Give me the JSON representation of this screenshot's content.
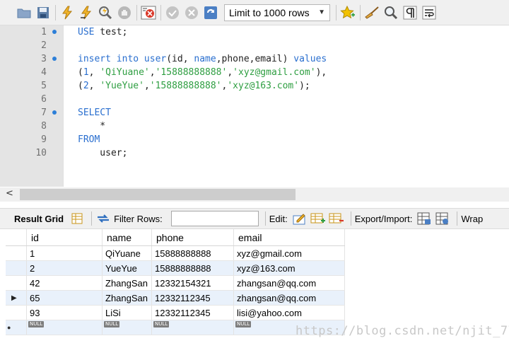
{
  "toolbar": {
    "limit_select_value": "Limit to 1000 rows",
    "buttons": [
      {
        "name": "open-folder-icon",
        "color": "#6f8fb8"
      },
      {
        "name": "save-icon",
        "color": "#5d7fa8"
      },
      {
        "name": "execute-lightning-icon",
        "color": "#e6a21c"
      },
      {
        "name": "execute-current-lightning-icon",
        "color": "#e6a21c"
      },
      {
        "name": "explain-magnifier-icon",
        "color": "#7a7a7a"
      },
      {
        "name": "stop-hand-icon",
        "color": "#9a9a9a"
      },
      {
        "name": "toggle-error-continue-icon",
        "color": "#d93a2b"
      },
      {
        "name": "commit-check-icon",
        "color": "#9a9a9a"
      },
      {
        "name": "rollback-cancel-icon",
        "color": "#9a9a9a"
      },
      {
        "name": "autocommit-toggle-icon",
        "color": "#4b7fc4"
      },
      {
        "name": "add-snippet-star-icon",
        "color": "#e8b400"
      },
      {
        "name": "beautify-broom-icon",
        "color": "#c08a2c"
      },
      {
        "name": "find-magnifier-icon",
        "color": "#555555"
      },
      {
        "name": "invisible-chars-pilcrow-icon",
        "color": "#333333"
      },
      {
        "name": "word-wrap-icon",
        "color": "#333333"
      }
    ]
  },
  "editor": {
    "lines": [
      {
        "num": "1",
        "marker": true
      },
      {
        "num": "2",
        "marker": false
      },
      {
        "num": "3",
        "marker": true
      },
      {
        "num": "4",
        "marker": false
      },
      {
        "num": "5",
        "marker": false
      },
      {
        "num": "6",
        "marker": false
      },
      {
        "num": "7",
        "marker": true
      },
      {
        "num": "8",
        "marker": false
      },
      {
        "num": "9",
        "marker": false
      },
      {
        "num": "10",
        "marker": false
      }
    ],
    "tokens": {
      "l1": [
        "USE",
        " test;"
      ],
      "l3": [
        "insert into user",
        "(id, ",
        "name",
        ",phone,email) ",
        "values"
      ],
      "l4": [
        "(",
        "1",
        ", ",
        "'QiYuane'",
        ",",
        "'15888888888'",
        ",",
        "'xyz@gmail.com'",
        "),"
      ],
      "l5": [
        "(",
        "2",
        ", ",
        "'YueYue'",
        ",",
        "'15888888888'",
        ",",
        "'xyz@163.com'",
        ");"
      ],
      "l7": [
        "SELECT"
      ],
      "l8": [
        "    *"
      ],
      "l9": [
        "FROM"
      ],
      "l10": [
        "    user;"
      ]
    }
  },
  "result_toolbar": {
    "result_grid_label": "Result Grid",
    "filter_label": "Filter Rows:",
    "filter_value": "",
    "edit_label": "Edit:",
    "export_label": "Export/Import:",
    "wrap_label": "Wrap"
  },
  "grid": {
    "columns": [
      "id",
      "name",
      "phone",
      "email"
    ],
    "rows": [
      {
        "id": "1",
        "name": "QiYuane",
        "phone": "15888888888",
        "email": "xyz@gmail.com",
        "current": false
      },
      {
        "id": "2",
        "name": "YueYue",
        "phone": "15888888888",
        "email": "xyz@163.com",
        "current": false
      },
      {
        "id": "42",
        "name": "ZhangSan",
        "phone": "12332154321",
        "email": "zhangsan@qq.com",
        "current": false
      },
      {
        "id": "65",
        "name": "ZhangSan",
        "phone": "12332112345",
        "email": "zhangsan@qq.com",
        "current": true
      },
      {
        "id": "93",
        "name": "LiSi",
        "phone": "12332112345",
        "email": "lisi@yahoo.com",
        "current": false
      }
    ],
    "null_label": "NULL",
    "current_row_marker": "▶",
    "new_row_marker": "●"
  },
  "watermark": "https://blog.csdn.net/njit_77"
}
